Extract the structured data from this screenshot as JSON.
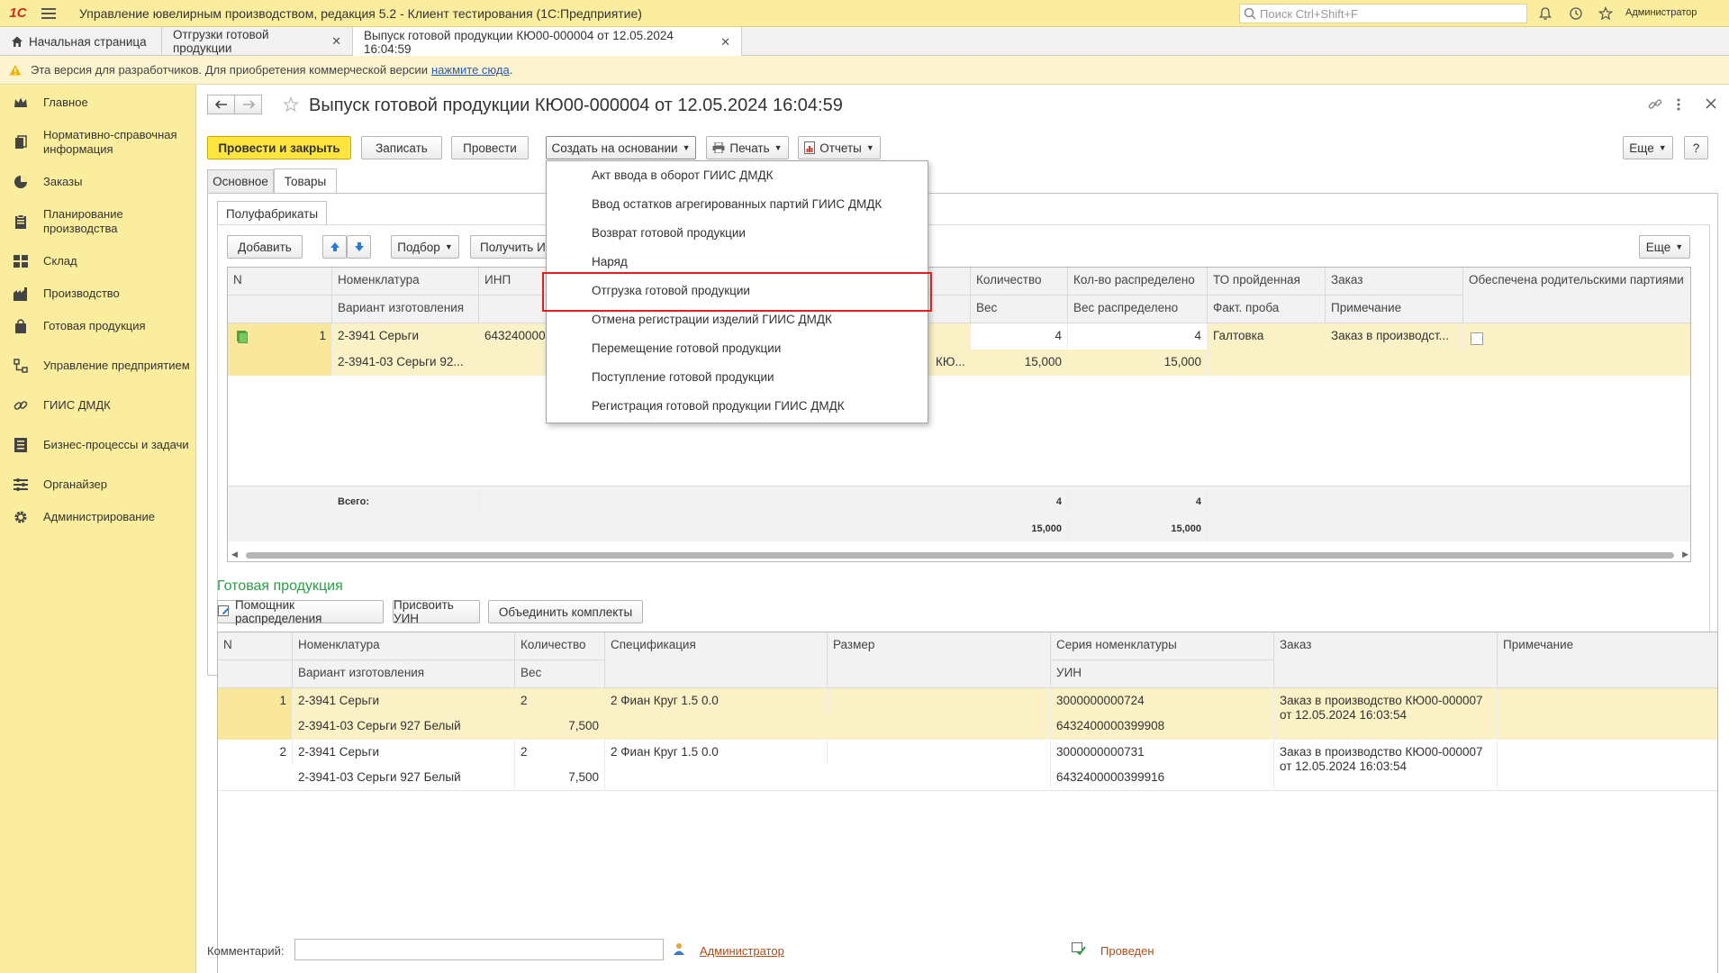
{
  "titlebar": {
    "logo": "1С",
    "title": "Управление ювелирным производством, редакция 5.2  - Клиент тестирования (1С:Предприятие)",
    "search_placeholder": "Поиск Ctrl+Shift+F",
    "user": "Администратор",
    "icons": [
      "menu-icon",
      "search-icon",
      "bell-icon",
      "history-icon",
      "star-icon"
    ]
  },
  "tabs": [
    {
      "label": "Начальная страница"
    },
    {
      "label": "Отгрузки готовой продукции"
    },
    {
      "label": "Выпуск готовой продукции КЮ00-000004 от 12.05.2024 16:04:59"
    }
  ],
  "warning": {
    "text": "Эта версия для разработчиков. Для приобретения коммерческой версии",
    "link": "нажмите сюда",
    "suffix": "."
  },
  "sidebar": {
    "items": [
      {
        "label": "Главное",
        "icon": "crown-icon"
      },
      {
        "label": "Нормативно-справочная информация",
        "icon": "books-icon"
      },
      {
        "label": "Заказы",
        "icon": "pie-chart-icon"
      },
      {
        "label": "Планирование производства",
        "icon": "clipboard-icon"
      },
      {
        "label": "Склад",
        "icon": "grid-icon"
      },
      {
        "label": "Производство",
        "icon": "factory-icon"
      },
      {
        "label": "Готовая продукция",
        "icon": "bag-icon"
      },
      {
        "label": "Управление предприятием",
        "icon": "org-icon"
      },
      {
        "label": "ГИИС ДМДК",
        "icon": "link-icon"
      },
      {
        "label": "Бизнес-процессы и задачи",
        "icon": "list-icon"
      },
      {
        "label": "Органайзер",
        "icon": "organizer-icon"
      },
      {
        "label": "Администрирование",
        "icon": "gear-icon"
      }
    ]
  },
  "document": {
    "title": "Выпуск готовой продукции КЮ00-000004 от 12.05.2024 16:04:59"
  },
  "toolbar": {
    "post_close": "Провести и закрыть",
    "save": "Записать",
    "post": "Провести",
    "create_based": "Создать на основании",
    "print": "Печать",
    "reports": "Отчеты",
    "more": "Еще",
    "help": "?"
  },
  "form_tabs": [
    "Основное",
    "Товары"
  ],
  "subtabs": [
    "Полуфабрикаты"
  ],
  "semi_toolbar": {
    "add": "Добавить",
    "pick": "Подбор",
    "get": "Получить И",
    "more": "Еще"
  },
  "semi_table": {
    "headers_top": [
      "N",
      "Номенклатура",
      "ИНП",
      "",
      "",
      "",
      "Количество",
      "Кол-во распределено",
      "ТО пройденная",
      "Заказ",
      "Обеспечена родительскими партиями"
    ],
    "headers_bottom": [
      "",
      "Вариант изготовления",
      "",
      "",
      "",
      "",
      "Вес",
      "Вес распределено",
      "Факт. проба",
      "Примечание",
      ""
    ],
    "rows": [
      {
        "n": "1",
        "nomenclature": "2-3941 Серьги",
        "variant": "2-3941-03 Серьги 92...",
        "inp": "643240000",
        "partial": "КЮ...",
        "qty": "4",
        "qty_dist": "4",
        "weight": "15,000",
        "weight_dist": "15,000",
        "to": "Галтовка",
        "order": "Заказ в производст...",
        "provided": false
      }
    ],
    "totals_label": "Всего:",
    "totals": {
      "qty": "4",
      "qty_dist": "4",
      "weight": "15,000",
      "weight_dist": "15,000"
    }
  },
  "dropdown": {
    "items": [
      "Акт ввода в оборот ГИИС ДМДК",
      "Ввод остатков агрегированных партий ГИИС ДМДК",
      "Возврат готовой продукции",
      "Наряд",
      "Отгрузка готовой продукции",
      "Отмена регистрации изделий ГИИС ДМДК",
      "Перемещение готовой продукции",
      "Поступление готовой продукции",
      "Регистрация готовой продукции ГИИС ДМДК"
    ],
    "highlighted_index": 4
  },
  "finished": {
    "title": "Готовая продукция",
    "buttons": {
      "assistant": "Помощник распределения",
      "assign_uin": "Присвоить УИН",
      "merge": "Объединить комплекты"
    },
    "headers_top": [
      "N",
      "Номенклатура",
      "Количество",
      "Спецификация",
      "Размер",
      "Серия номенклатуры",
      "Заказ",
      "Примечание"
    ],
    "headers_bottom": [
      "",
      "Вариант изготовления",
      "Вес",
      "",
      "",
      "УИН",
      "",
      ""
    ],
    "rows": [
      {
        "n": "1",
        "nomenclature": "2-3941 Серьги",
        "variant": "2-3941-03 Серьги 927 Белый",
        "qty": "2",
        "weight": "7,500",
        "spec": "2 Фиан Круг 1.5 0.0",
        "size": "",
        "series": "3000000000724",
        "uin": "6432400000399908",
        "order_line1": "Заказ в производство КЮ00-000007",
        "order_line2": "от 12.05.2024 16:03:54",
        "note": ""
      },
      {
        "n": "2",
        "nomenclature": "2-3941 Серьги",
        "variant": "2-3941-03 Серьги 927 Белый",
        "qty": "2",
        "weight": "7,500",
        "spec": "2 Фиан Круг 1.5 0.0",
        "size": "",
        "series": "3000000000731",
        "uin": "6432400000399916",
        "order_line1": "Заказ в производство КЮ00-000007",
        "order_line2": "от 12.05.2024 16:03:54",
        "note": ""
      }
    ]
  },
  "footer": {
    "comment_label": "Комментарий:",
    "comment_value": "",
    "author": "Администратор",
    "status": "Проведен"
  }
}
